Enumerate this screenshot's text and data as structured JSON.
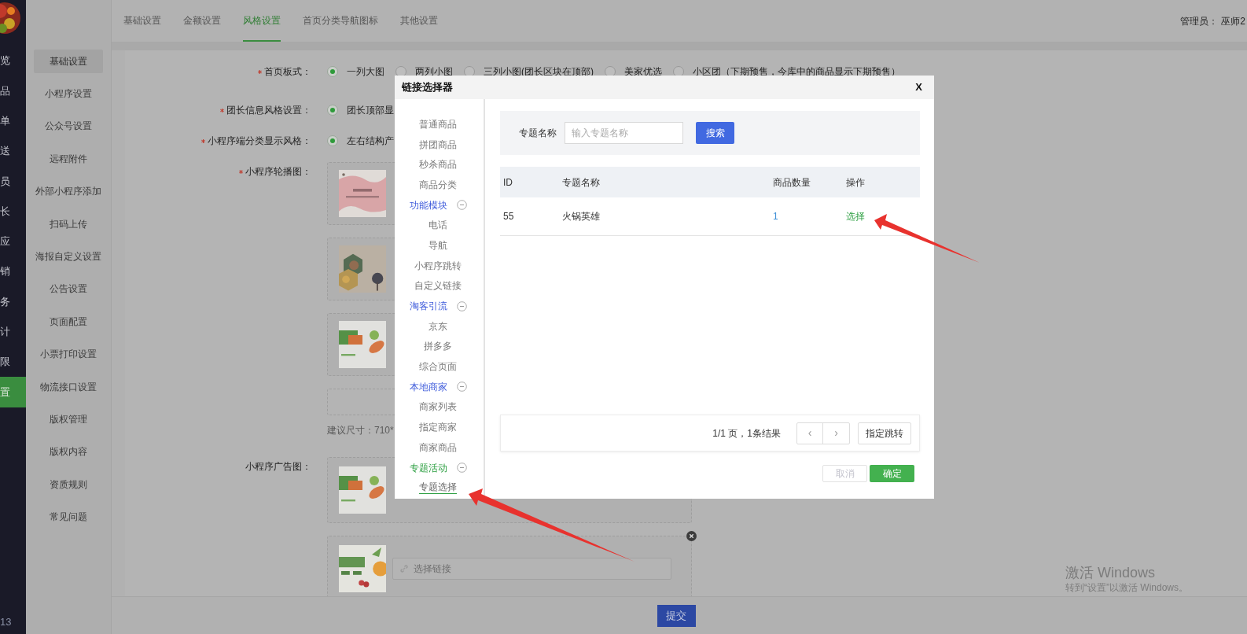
{
  "app_nav": {
    "items": [
      {
        "label": "览",
        "selected": false
      },
      {
        "label": "品",
        "selected": false
      },
      {
        "label": "单",
        "selected": false
      },
      {
        "label": "送",
        "selected": false
      },
      {
        "label": "员",
        "selected": false
      },
      {
        "label": "长",
        "selected": false
      },
      {
        "label": "应",
        "selected": false
      },
      {
        "label": "销",
        "selected": false
      },
      {
        "label": "务",
        "selected": false
      },
      {
        "label": "计",
        "selected": false
      },
      {
        "label": "限",
        "selected": false
      },
      {
        "label": "置",
        "selected": true
      }
    ],
    "footer": "13"
  },
  "settings_nav": {
    "items": [
      {
        "label": "基础设置",
        "selected": true
      },
      {
        "label": "小程序设置",
        "selected": false
      },
      {
        "label": "公众号设置",
        "selected": false
      },
      {
        "label": "远程附件",
        "selected": false
      },
      {
        "label": "外部小程序添加",
        "selected": false
      },
      {
        "label": "扫码上传",
        "selected": false
      },
      {
        "label": "海报自定义设置",
        "selected": false
      },
      {
        "label": "公告设置",
        "selected": false
      },
      {
        "label": "页面配置",
        "selected": false
      },
      {
        "label": "小票打印设置",
        "selected": false
      },
      {
        "label": "物流接口设置",
        "selected": false
      },
      {
        "label": "版权管理",
        "selected": false
      },
      {
        "label": "版权内容",
        "selected": false
      },
      {
        "label": "资质规则",
        "selected": false
      },
      {
        "label": "常见问题",
        "selected": false
      }
    ]
  },
  "tabs": [
    {
      "label": "基础设置",
      "selected": false
    },
    {
      "label": "金额设置",
      "selected": false
    },
    {
      "label": "风格设置",
      "selected": true
    },
    {
      "label": "首页分类导航图标",
      "selected": false
    },
    {
      "label": "其他设置",
      "selected": false
    }
  ],
  "admin": {
    "label": "管理员：",
    "name": "巫师2"
  },
  "form": {
    "fields": [
      {
        "kind": "radio",
        "label": "首页板式：",
        "required": true,
        "options": [
          {
            "label": "一列大图",
            "selected": true
          },
          {
            "label": "两列小图",
            "selected": false
          },
          {
            "label": "三列小图(团长区块在顶部)",
            "selected": false
          },
          {
            "label": "美家优选",
            "selected": false
          },
          {
            "label": "小区团（下期预售，今库中的商品显示下期预售）",
            "selected": false
          }
        ]
      },
      {
        "kind": "radio",
        "label": "团长信息风格设置：",
        "required": true,
        "options": [
          {
            "label": "团长顶部显",
            "selected": true
          }
        ]
      },
      {
        "kind": "radio",
        "label": "小程序端分类显示风格：",
        "required": true,
        "options": [
          {
            "label": "左右结构产",
            "selected": true
          }
        ]
      },
      {
        "kind": "images",
        "label": "小程序轮播图：",
        "required": true,
        "images": [
          {
            "kind": "picture"
          },
          {
            "kind": "picture"
          },
          {
            "kind": "picture"
          },
          {
            "kind": "empty"
          }
        ],
        "hint": "建议尺寸：710*"
      },
      {
        "kind": "images",
        "label": "小程序广告图：",
        "required": false,
        "images": [
          {
            "kind": "picture"
          },
          {
            "kind": "picture",
            "link_placeholder": "选择链接",
            "removable": true
          }
        ]
      }
    ]
  },
  "submit": "提交",
  "modal": {
    "title": "链接选择器",
    "close": "X",
    "tree": [
      {
        "children": [
          {
            "label": "普通商品",
            "selected": false
          },
          {
            "label": "拼团商品",
            "selected": false
          },
          {
            "label": "秒杀商品",
            "selected": false
          },
          {
            "label": "商品分类",
            "selected": false
          }
        ]
      },
      {
        "label": "功能模块",
        "selected": false,
        "expanded": true,
        "children": [
          {
            "label": "电话",
            "selected": false
          },
          {
            "label": "导航",
            "selected": false
          },
          {
            "label": "小程序跳转",
            "selected": false
          },
          {
            "label": "自定义链接",
            "selected": false
          }
        ]
      },
      {
        "label": "淘客引流",
        "selected": false,
        "expanded": true,
        "children": [
          {
            "label": "京东",
            "selected": false
          },
          {
            "label": "拼多多",
            "selected": false
          },
          {
            "label": "综合页面",
            "selected": false
          }
        ]
      },
      {
        "label": "本地商家",
        "selected": false,
        "expanded": true,
        "children": [
          {
            "label": "商家列表",
            "selected": false
          },
          {
            "label": "指定商家",
            "selected": false
          },
          {
            "label": "商家商品",
            "selected": false
          }
        ]
      },
      {
        "label": "专题活动",
        "selected": true,
        "expanded": true,
        "children": [
          {
            "label": "专题选择",
            "selected": true
          }
        ]
      }
    ],
    "search": {
      "label": "专题名称",
      "placeholder": "输入专题名称",
      "button": "搜索"
    },
    "table": {
      "columns": [
        "ID",
        "专题名称",
        "商品数量",
        "操作"
      ],
      "rows": [
        [
          "55",
          "火锅英雄",
          "1",
          "选择"
        ]
      ]
    },
    "pagination": {
      "summary": "1/1 页，1条结果",
      "prev": "‹",
      "next": "›",
      "jump": "指定跳转"
    },
    "buttons": [
      {
        "label": "取消",
        "kind": "cancel"
      },
      {
        "label": "确定",
        "kind": "confirm"
      }
    ]
  },
  "os_notice": {
    "title": "激活 Windows",
    "subtitle": "转到“设置”以激活 Windows。"
  }
}
